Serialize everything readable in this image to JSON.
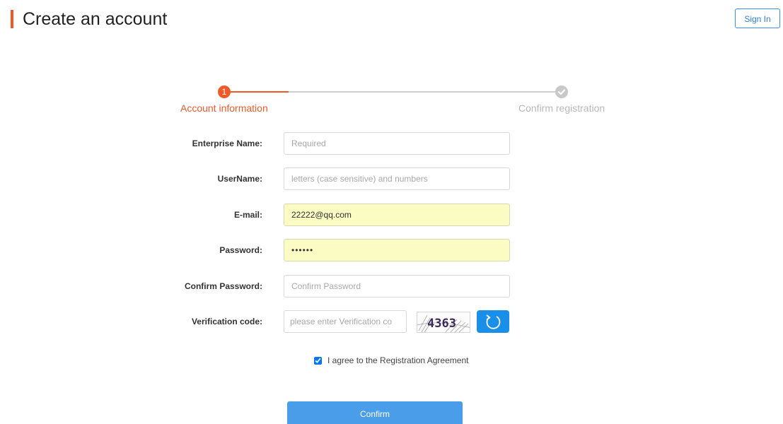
{
  "header": {
    "title": "Create an account",
    "signin_label": "Sign In"
  },
  "stepper": {
    "step1_number": "1",
    "step1_label": "Account information",
    "step2_label": "Confirm registration",
    "step2_icon": "check-icon"
  },
  "form": {
    "enterprise_name": {
      "label": "Enterprise Name:",
      "placeholder": "Required",
      "value": ""
    },
    "username": {
      "label": "UserName:",
      "placeholder": "letters (case sensitive) and numbers",
      "value": ""
    },
    "email": {
      "label": "E-mail:",
      "placeholder": "",
      "value": "22222@qq.com"
    },
    "password": {
      "label": "Password:",
      "placeholder": "",
      "value": "••••••"
    },
    "confirm_password": {
      "label": "Confirm Password:",
      "placeholder": "Confirm Password",
      "value": ""
    },
    "verification": {
      "label": "Verification code:",
      "placeholder": "please enter Verification co",
      "captcha_text": "4363",
      "refresh_icon": "refresh-icon"
    }
  },
  "agreement": {
    "label": "I agree to the Registration Agreement",
    "checked": true
  },
  "confirm_label": "Confirm",
  "colors": {
    "accent": "#f05a28",
    "primary_blue": "#1a8fe8",
    "confirm_blue": "#4a9de8",
    "autofill": "#fafcc4"
  }
}
